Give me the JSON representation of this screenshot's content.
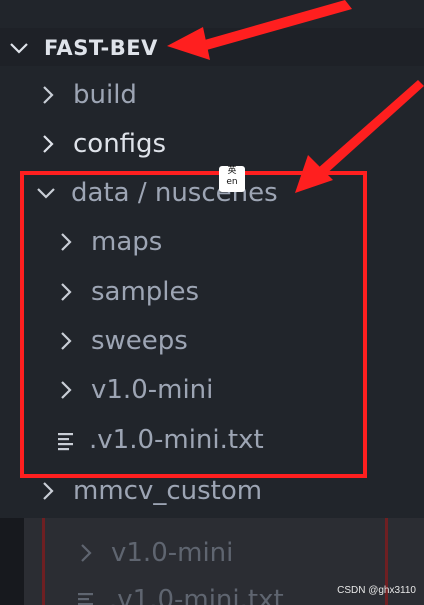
{
  "explorer": {
    "root": "FAST-BEV",
    "items": [
      {
        "label": "build",
        "icon": "chevron-right-icon"
      },
      {
        "label": "configs",
        "icon": "chevron-right-icon"
      },
      {
        "label": "data / nuscenes",
        "icon": "chevron-down-icon"
      },
      {
        "label": "maps",
        "icon": "chevron-right-icon"
      },
      {
        "label": "samples",
        "icon": "chevron-right-icon"
      },
      {
        "label": "sweeps",
        "icon": "chevron-right-icon"
      },
      {
        "label": "v1.0-mini",
        "icon": "chevron-right-icon"
      },
      {
        "label": ".v1.0-mini.txt",
        "icon": "text-file-icon"
      },
      {
        "label": "mmcv_custom",
        "icon": "chevron-right-icon"
      }
    ]
  },
  "overlay": {
    "badge_top": "英",
    "badge_bottom": "en",
    "annotation_color": "#ff1f1f"
  },
  "background_echo": {
    "items": [
      {
        "label": "v1.0-mini"
      },
      {
        "label": ".v1.0-mini.txt"
      }
    ]
  },
  "watermark": "CSDN @ghx3110"
}
